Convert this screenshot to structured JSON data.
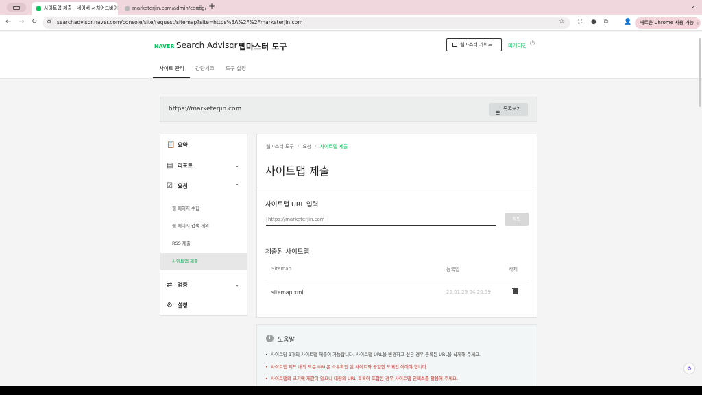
{
  "browser": {
    "tabs": [
      {
        "title": "사이트맵 제출 - 네이버 서치어드바이",
        "active": true,
        "favicon_color": "#03c75a"
      },
      {
        "title": "marketerjin.com/admin/config/",
        "active": false,
        "favicon_color": "#bbbbbb"
      }
    ],
    "address": "searchadvisor.naver.com/console/site/request/sitemap?site=https%3A%2F%2Fmarketerjin.com",
    "chrome_pill": "새로운 Chrome 사용 가능",
    "icons": {
      "back": "arrow-left-icon",
      "forward": "arrow-right-icon",
      "reload": "reload-icon",
      "star": "star-icon"
    }
  },
  "header": {
    "naver_logo": "NAVER",
    "search_advisor": "Search Advisor",
    "webmaster": "웹마스터 도구",
    "guide_button": "웹마스터 가이드",
    "user_name": "마케터진",
    "nav": [
      "사이트 관리",
      "간단체크",
      "도구 설정"
    ]
  },
  "site": {
    "url": "https://marketerjin.com",
    "list_button": "목록보기"
  },
  "sidebar": {
    "items": [
      {
        "label": "요약",
        "icon": "clipboard-icon"
      },
      {
        "label": "리포트",
        "icon": "chart-icon"
      },
      {
        "label": "요청",
        "icon": "checkbox-icon"
      },
      {
        "label": "검증",
        "icon": "repeat-icon"
      },
      {
        "label": "설정",
        "icon": "gear-icon"
      }
    ],
    "sub_items": [
      "웹 페이지 수집",
      "웹 페이지 검색 제외",
      "RSS 제출",
      "사이트맵 제출"
    ]
  },
  "main": {
    "breadcrumb": [
      "웹마스터 도구",
      "요청",
      "사이트맵 제출"
    ],
    "title": "사이트맵 제출",
    "url_section_title": "사이트맵 URL 입력",
    "input_placeholder": "https://marketerjin.com",
    "confirm_button": "확인",
    "submitted_title": "제출된 사이트맵",
    "table": {
      "headers": [
        "Sitemap",
        "등록일",
        "삭제"
      ],
      "rows": [
        {
          "sitemap": "sitemap.xml",
          "date": "25.01.29 04:20:59"
        }
      ]
    }
  },
  "help": {
    "title": "도움말",
    "items": [
      {
        "text": "사이트당 1개의 사이트맵 제출이 가능합니다. 사이트맵 URL을 변경하고 싶은 경우 등록된 URL을 삭제해 주세요.",
        "emphasis": false
      },
      {
        "text": "사이트맵 피드 내의 모든 URL은 소유확인 된 사이트와 동일한 도메인 이어야 합니다.",
        "emphasis": true
      },
      {
        "text": "사이트맵의 크기에 제한이 있으니 대량의 URL 목록이 포함된 경우 사이트맵 인덱스를 활용해 주세요.",
        "emphasis": true
      }
    ]
  },
  "colors": {
    "accent": "#03c75a",
    "warning": "#c0392b"
  }
}
